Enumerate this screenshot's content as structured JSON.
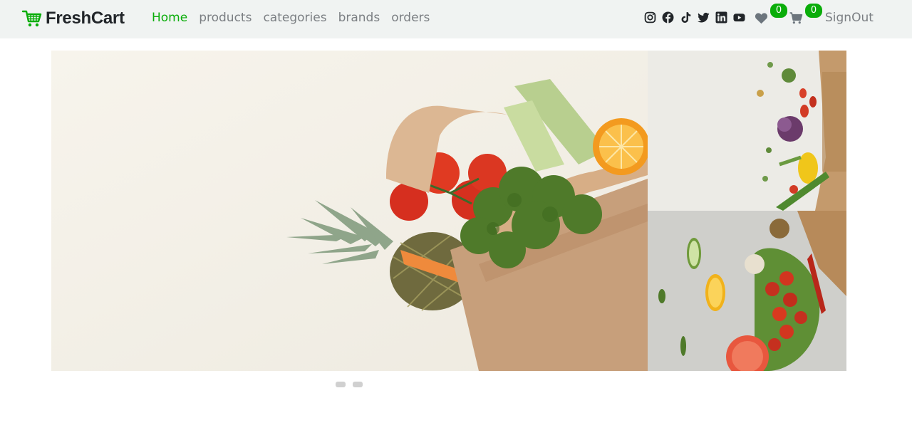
{
  "brand": {
    "name": "FreshCart",
    "icon": "cart-icon",
    "color": "#0aad0a"
  },
  "nav": {
    "links": [
      {
        "label": "Home",
        "active": true
      },
      {
        "label": "products",
        "active": false
      },
      {
        "label": "categories",
        "active": false
      },
      {
        "label": "brands",
        "active": false
      },
      {
        "label": "orders",
        "active": false
      }
    ]
  },
  "socials": [
    "instagram-icon",
    "facebook-icon",
    "tiktok-icon",
    "twitter-icon",
    "linkedin-icon",
    "youtube-icon"
  ],
  "wishlist": {
    "icon": "heart-icon",
    "count": "0"
  },
  "cart": {
    "icon": "cart-icon",
    "count": "0"
  },
  "auth": {
    "signout_label": "SignOut"
  },
  "slider": {
    "slides": 2,
    "active_index": 0
  },
  "colors": {
    "accent": "#0aad0a",
    "navbar_bg": "#f0f3f2",
    "muted_text": "#7b7f83"
  }
}
